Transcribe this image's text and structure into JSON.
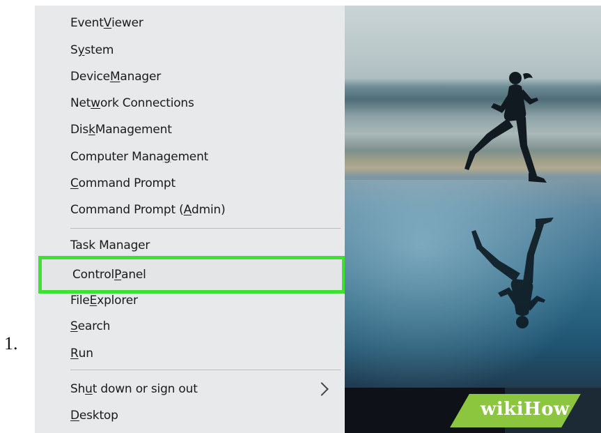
{
  "step_number": "1.",
  "menu": {
    "items": [
      {
        "pre": "Event ",
        "u": "V",
        "post": "iewer"
      },
      {
        "pre": "S",
        "u": "y",
        "post": "stem"
      },
      {
        "pre": "Device ",
        "u": "M",
        "post": "anager"
      },
      {
        "pre": "Net",
        "u": "w",
        "post": "ork Connections"
      },
      {
        "pre": "Dis",
        "u": "k",
        "post": " Management"
      },
      {
        "pre": "Computer Mana",
        "u": "g",
        "post": "ement"
      },
      {
        "pre": "",
        "u": "C",
        "post": "ommand Prompt"
      },
      {
        "pre": "Command Prompt (",
        "u": "A",
        "post": "dmin)"
      },
      {
        "pre": "Task Manager",
        "u": "",
        "post": ""
      },
      {
        "pre": "Control ",
        "u": "P",
        "post": "anel"
      },
      {
        "pre": "File ",
        "u": "E",
        "post": "xplorer"
      },
      {
        "pre": "",
        "u": "S",
        "post": "earch"
      },
      {
        "pre": "",
        "u": "R",
        "post": "un"
      },
      {
        "pre": "Sh",
        "u": "u",
        "post": "t down or sign out"
      },
      {
        "pre": "",
        "u": "D",
        "post": "esktop"
      }
    ],
    "highlighted_item": "Control Panel",
    "highlight_color": "#3fe02f"
  },
  "watermark": {
    "text": "wikiHow"
  },
  "icons": {
    "submenu": "chevron-right-icon"
  }
}
